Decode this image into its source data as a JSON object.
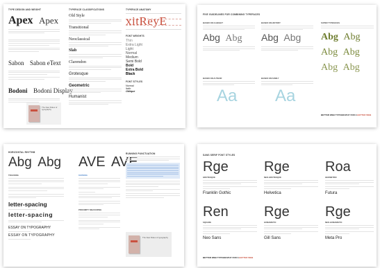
{
  "card1": {
    "col1_heading": "TYPE DESIGN AND WEIGHT",
    "apex_a": "Apex",
    "apex_b": "Apex",
    "salmon_a": "Sabon",
    "salmon_b": "Sabon eText",
    "bodoni_a": "Bodoni",
    "bodoni_b": "Bodoni Display",
    "book_caption": "The New Rules of typography"
  },
  "card2": {
    "heading": "TYPEFACE CLASSIFICATIONS",
    "classes": [
      "Old Style",
      "Transitional",
      "Neoclassical",
      "Slab",
      "Clarendon",
      "Grotesque",
      "Geometric",
      "Humanist"
    ]
  },
  "card3": {
    "heading": "TYPEFACE ANATOMY",
    "anatomy_word": "xitReyE",
    "weights_heading": "FONT WEIGHTS",
    "weights": [
      "Thin",
      "Extra Light",
      "Light",
      "Normal",
      "Medium",
      "Semi Bold",
      "Bold",
      "Extra Bold",
      "Black"
    ],
    "styles_heading": "FONT STYLES",
    "styles": [
      "Normal",
      "Italic",
      "Oblique"
    ]
  },
  "card4": {
    "heading": "FIVE GUIDELINES FOR COMBINING TYPEFACES",
    "sections": [
      "BASED ON X-HEIGHT",
      "BASED ON HISTORY",
      "SUPER TYPEFACES",
      "BASED ON AUTHOR",
      "BASED ON FAMILY"
    ],
    "sample": "Abg",
    "aa": "Aa",
    "footer_a": "BETTER WEB TYPOGRAPHY FOR A ",
    "footer_b": "BETTER WEB"
  },
  "card5": {
    "heading": "HORIZONTAL RHYTHM",
    "abg": "Abg",
    "ave": "AVE",
    "tracking": "TRACKING",
    "letter_spacing": "letter-spacing",
    "essay_a": "ESSAY ON TYPOGRAPHY",
    "essay_b": "ESSAY ON TYPOGRAPHY",
    "kerning": "KERNING",
    "prox": "PROXIMITY MEASURING",
    "runaround_heading": "RUNNING PUNCTUATION",
    "book_caption": "The New Rules of typography"
  },
  "card6": {
    "heading": "SANS SERIF FONT STYLES",
    "glyphs": [
      "Rge",
      "Rge",
      "Roa",
      "Ren",
      "Rge",
      "Rge"
    ],
    "cats": [
      "GROTESQUE",
      "NEO-GROTESQUE",
      "GEOMETRIC",
      "SQUARE",
      "HUMANISTIC",
      "NEO-HUMANISTIC"
    ],
    "names": [
      "Franklin Gothic",
      "Helvetica",
      "Futura",
      "Neo Sans",
      "Gill Sans",
      "Meta Pro"
    ],
    "footer_a": "BETTER WEB TYPOGRAPHY FOR A ",
    "footer_b": "BETTER WEB"
  },
  "colors": {
    "accent": "#c9513f",
    "green": "#6e7d2e",
    "teal": "#8fc5d6",
    "blue": "#5b8fcf"
  }
}
